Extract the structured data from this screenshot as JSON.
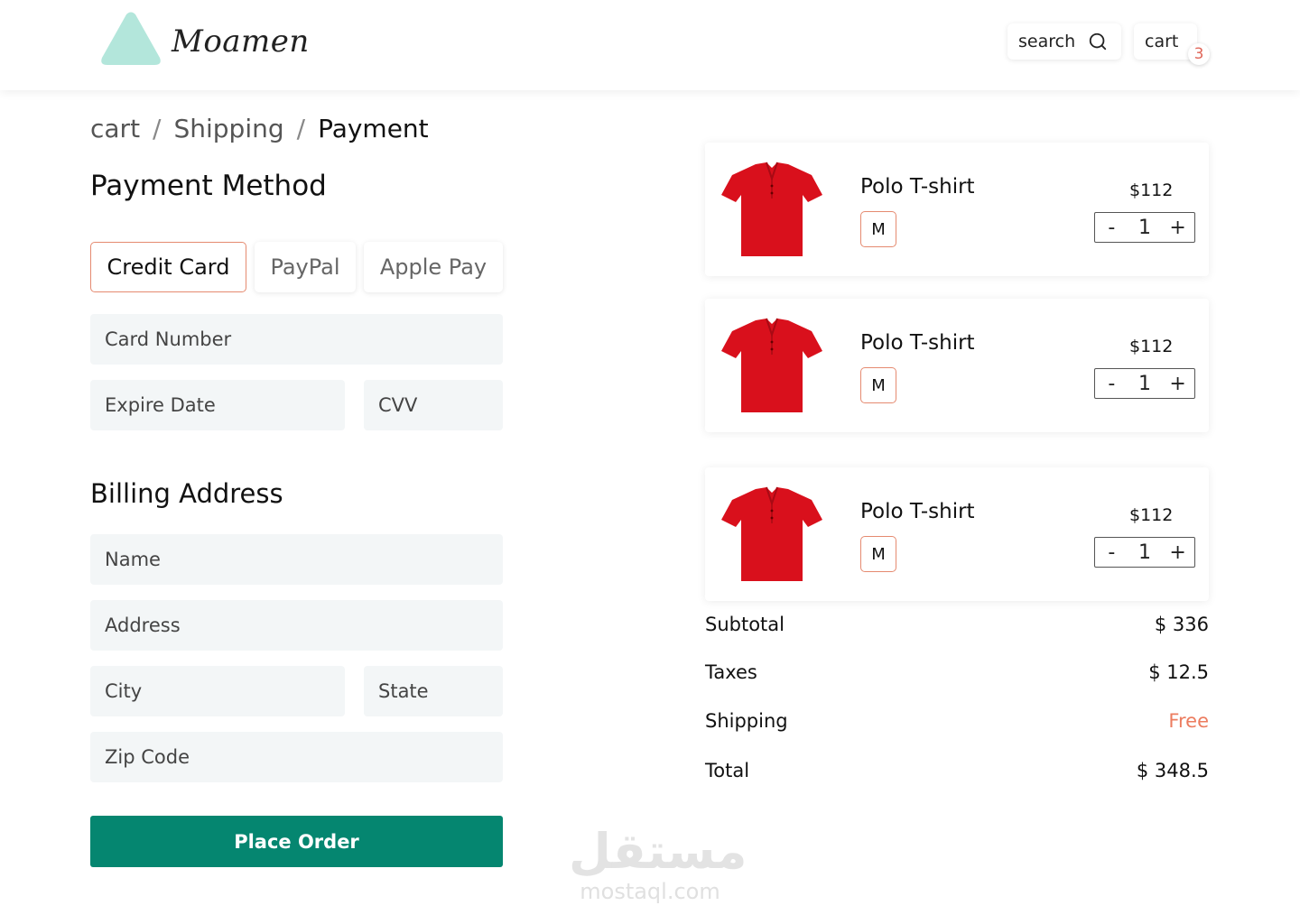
{
  "header": {
    "logo_text": "Moamen",
    "logo_color": "#b3e6db",
    "search_label": "search",
    "cart_label": "cart",
    "cart_count": "3"
  },
  "breadcrumb": {
    "items": [
      "cart",
      "Shipping",
      "Payment"
    ],
    "separator": "/"
  },
  "payment": {
    "title": "Payment Method",
    "tabs": [
      {
        "label": "Credit Card",
        "active": true
      },
      {
        "label": "PayPal",
        "active": false
      },
      {
        "label": "Apple Pay",
        "active": false
      }
    ],
    "card_number_placeholder": "Card Number",
    "expire_placeholder": "Expire Date",
    "cvv_placeholder": "CVV"
  },
  "billing": {
    "title": "Billing Address",
    "name_placeholder": "Name",
    "address_placeholder": "Address",
    "city_placeholder": "City",
    "state_placeholder": "State",
    "zip_placeholder": "Zip Code"
  },
  "place_order_label": "Place Order",
  "cart_items": [
    {
      "name": "Polo T-shirt",
      "size": "M",
      "price": "$112",
      "minus": "-",
      "qty": "1",
      "plus": "+"
    },
    {
      "name": "Polo T-shirt",
      "size": "M",
      "price": "$112",
      "minus": "-",
      "qty": "1",
      "plus": "+"
    },
    {
      "name": "Polo T-shirt",
      "size": "M",
      "price": "$112",
      "minus": "-",
      "qty": "1",
      "plus": "+"
    }
  ],
  "summary": {
    "subtotal_label": "Subtotal",
    "subtotal_value": "$ 336",
    "taxes_label": "Taxes",
    "taxes_value": "$ 12.5",
    "shipping_label": "Shipping",
    "shipping_value": "Free",
    "total_label": "Total",
    "total_value": "$ 348.5"
  },
  "watermark": {
    "arabic": "مستقل",
    "site": "mostaql.com"
  },
  "colors": {
    "accent_green": "#058670",
    "accent_orange": "#e58a70",
    "free_text": "#ec7c5f",
    "field_bg": "#f3f6f7",
    "shirt_red": "#d9101c"
  }
}
